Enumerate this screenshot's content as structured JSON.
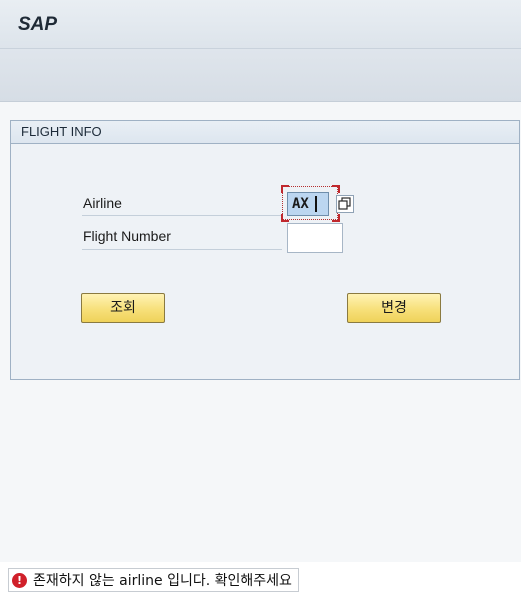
{
  "app": {
    "title": "SAP"
  },
  "group": {
    "title": "FLIGHT INFO"
  },
  "fields": {
    "airline": {
      "label": "Airline",
      "value": "AX"
    },
    "flight_number": {
      "label": "Flight Number",
      "value": ""
    }
  },
  "buttons": {
    "query_label": "조회",
    "change_label": "변경"
  },
  "status": {
    "type": "error",
    "message": "존재하지 않는 airline 입니다. 확인해주세요"
  },
  "icons": {
    "value_help": "value-help-icon",
    "status": "error-icon"
  },
  "colors": {
    "button_fill": "#f7e07a",
    "error": "#d0202a",
    "focus_marker": "#c0282d"
  }
}
